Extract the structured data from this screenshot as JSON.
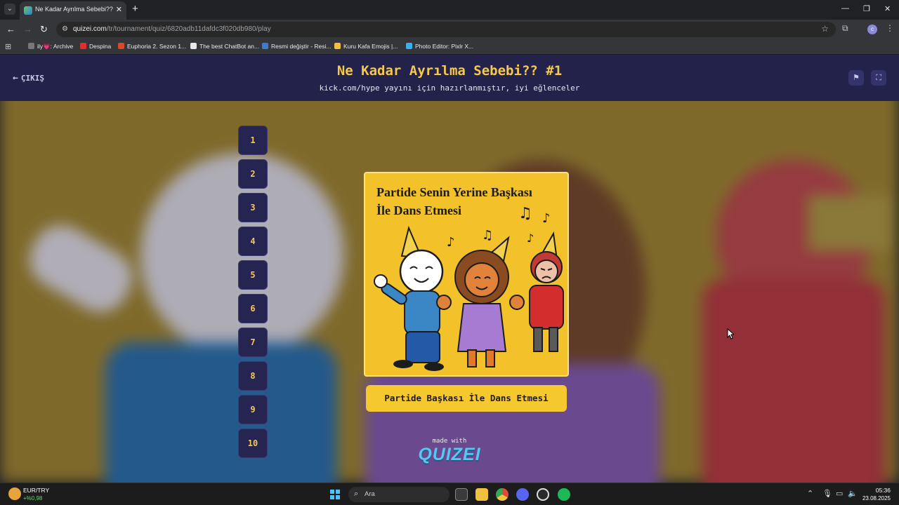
{
  "browser": {
    "tab_title": "Ne Kadar Ayrılma Sebebi?? #1",
    "url_host": "quizei.com",
    "url_path": "/tr/tournament/quiz/6820adb11dafdc3f020db980/play",
    "bookmarks": [
      {
        "label": "ily💗: Archive",
        "color": "#777777"
      },
      {
        "label": "Despina",
        "color": "#e02f2f"
      },
      {
        "label": "Euphoria 2. Sezon 1...",
        "color": "#d94a2a"
      },
      {
        "label": "The best ChatBot an...",
        "color": "#e8e8e8"
      },
      {
        "label": "Resmi değiştir - Resi...",
        "color": "#3a7bd5"
      },
      {
        "label": "Kuru Kafa Emojis |...",
        "color": "#f0c040"
      },
      {
        "label": "Photo Editor: Pixlr X...",
        "color": "#3ab0f0"
      }
    ]
  },
  "header": {
    "exit_label": "ÇIKIŞ",
    "title": "Ne Kadar Ayrılma Sebebi?? #1",
    "subtitle": "kick.com/hype yayını için hazırlanmıştır, iyi eğlenceler"
  },
  "rounds": [
    "1",
    "2",
    "3",
    "4",
    "5",
    "6",
    "7",
    "8",
    "9",
    "10"
  ],
  "card": {
    "heading_line1": "Partide Senin Yerine Başkası",
    "heading_line2": "İle Dans Etmesi"
  },
  "answer_label": "Partide Başkası İle Dans Etmesi",
  "footer": {
    "made_with": "made with",
    "brand": "QUIZEI"
  },
  "taskbar": {
    "ticker_name": "EUR/TRY",
    "ticker_value": "+%0,98",
    "search_placeholder": "Ara",
    "time": "05:36",
    "date": "23.08.2025"
  },
  "colors": {
    "accent_yellow": "#f6c94a",
    "header_bg": "#23224a",
    "round_bg": "#262451"
  }
}
